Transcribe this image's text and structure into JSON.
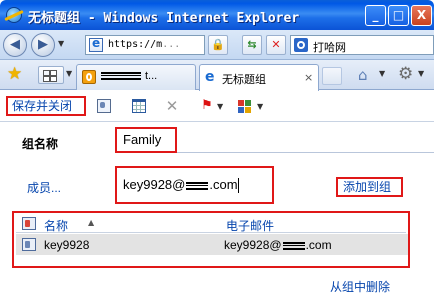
{
  "window": {
    "title": "无标题组 - Windows Internet Explorer",
    "min_symbol": "_",
    "max_symbol": "□",
    "close_symbol": "X"
  },
  "address_bar": {
    "url_visible": "https://m",
    "url_trail": "...",
    "search_provider": "打哈网"
  },
  "tabs": [
    {
      "label_suffix": "t..."
    },
    {
      "label": "无标题组",
      "close_symbol": "×",
      "active": true
    }
  ],
  "toolbar": {
    "save_close_label": "保存并关闭",
    "delete_symbol": "✕",
    "flag_symbol": "⚑"
  },
  "form": {
    "group_name_label": "组名称",
    "group_name_value": "Family",
    "members_link": "成员...",
    "email_input_prefix": "key9928@",
    "email_input_suffix": ".com",
    "add_to_group_label": "添加到组"
  },
  "members_table": {
    "columns": [
      "名称",
      "电子邮件"
    ],
    "rows": [
      {
        "name": "key9928",
        "email_prefix": "key9928@",
        "email_suffix": ".com"
      }
    ]
  },
  "remove_from_group_label": "从组中删除",
  "colors": {
    "highlight_border": "#e01818",
    "link": "#0645ad",
    "titlebar": "#0058e6",
    "selected_row": "#e3e3e3"
  },
  "icons": [
    "back-icon",
    "forward-icon",
    "page-icon",
    "lock-icon",
    "refresh-icon",
    "stop-icon",
    "search-provider-icon",
    "favorites-star-icon",
    "quick-tabs-icon",
    "outlook-icon",
    "ie-icon",
    "home-icon",
    "tools-gear-icon",
    "contact-icon",
    "calendar-icon",
    "delete-icon",
    "flag-icon",
    "categorize-icon",
    "group-icon",
    "contact-row-icon"
  ]
}
